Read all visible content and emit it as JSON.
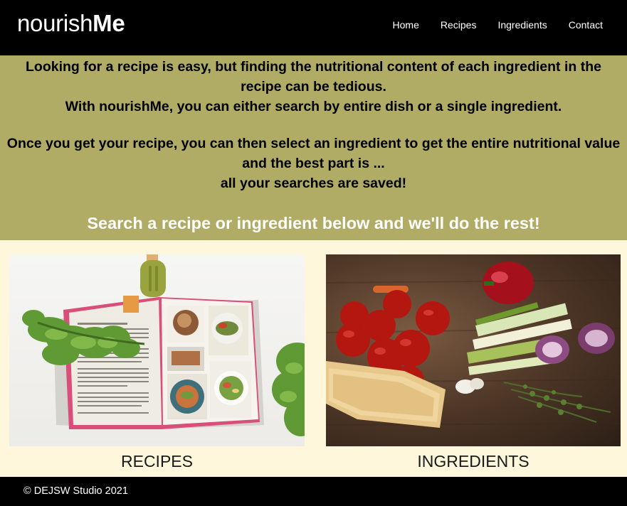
{
  "brand": {
    "part1": "nourish",
    "part2": "Me"
  },
  "nav": [
    "Home",
    "Recipes",
    "Ingredients",
    "Contact"
  ],
  "intro": {
    "line1": "Looking for a recipe is easy, but finding the nutritional content of each ingredient in the",
    "line2": "recipe can be tedious.",
    "line3": "With nourishMe, you can either search by entire dish or a single ingredient.",
    "line4": "Once you get your recipe, you can then select an ingredient to get the entire nutritional value",
    "line5": "and the best part is ...",
    "line6": "all your searches are saved!",
    "cta": "Search a recipe or ingredient below and we'll do the rest!"
  },
  "cards": [
    {
      "label": "RECIPES",
      "icon": "recipe-book-image"
    },
    {
      "label": "INGREDIENTS",
      "icon": "ingredients-image"
    }
  ],
  "footer": {
    "symbol": "©",
    "text": "DEJSW Studio 2021"
  },
  "colors": {
    "nav_bg": "#000000",
    "intro_bg": "#b0ac65",
    "cards_bg": "#fff7dc",
    "footer_bg": "#000000"
  }
}
